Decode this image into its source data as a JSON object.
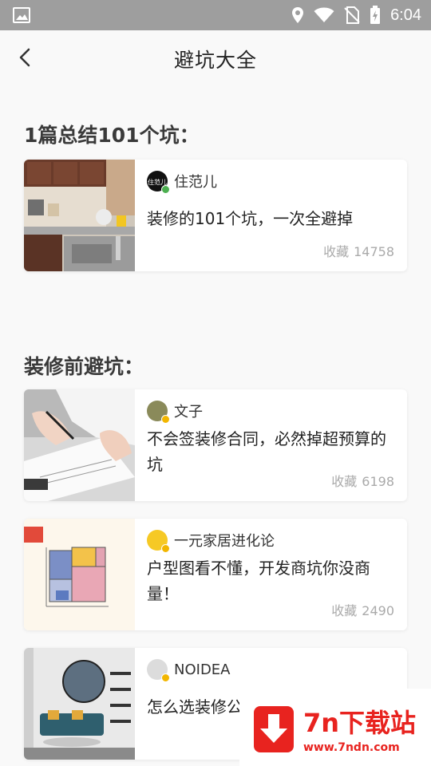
{
  "status_bar": {
    "time": "6:04",
    "icons": [
      "image-icon",
      "location-icon",
      "wifi-icon",
      "no-sim-icon",
      "battery-icon"
    ]
  },
  "header": {
    "title": "避坑大全",
    "back_icon": "back-arrow-icon"
  },
  "sections": [
    {
      "title": "1篇总结101个坑：",
      "cards": [
        {
          "author": "住范儿",
          "title": "装修的101个坑，一次全避掉",
          "fav_label": "收藏",
          "fav_count": "14758"
        }
      ]
    },
    {
      "title": "装修前避坑：",
      "cards": [
        {
          "author": "文子",
          "title": "不会签装修合同，必然掉超预算的坑",
          "fav_label": "收藏",
          "fav_count": "6198"
        },
        {
          "author": "一元家居进化论",
          "title": "户型图看不懂，开发商坑你没商量！",
          "fav_label": "收藏",
          "fav_count": "2490"
        },
        {
          "author": "NOIDEA",
          "title": "怎么选装修公",
          "fav_label": "",
          "fav_count": ""
        }
      ]
    }
  ],
  "watermark": {
    "brand": "7n下载站",
    "site": "www.7ndn.com"
  },
  "colors": {
    "status_bar": "#9e9e9e",
    "background": "#f9f9f9",
    "watermark_red": "#e8231f",
    "verified_green": "#4caf50"
  }
}
